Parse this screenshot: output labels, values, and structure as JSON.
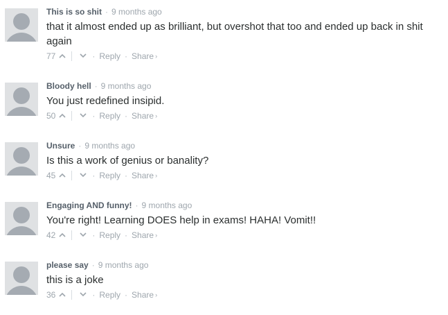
{
  "comments": [
    {
      "author": "This is so shit",
      "time": "9 months ago",
      "message": "that it almost ended up as brilliant, but overshot that too and ended up back in shit again",
      "votes": "77",
      "reply_label": "Reply",
      "share_label": "Share"
    },
    {
      "author": "Bloody hell",
      "time": "9 months ago",
      "message": "You just redefined insipid.",
      "votes": "50",
      "reply_label": "Reply",
      "share_label": "Share"
    },
    {
      "author": "Unsure",
      "time": "9 months ago",
      "message": "Is this a work of genius or banality?",
      "votes": "45",
      "reply_label": "Reply",
      "share_label": "Share"
    },
    {
      "author": "Engaging AND funny!",
      "time": "9 months ago",
      "message": "You're right! Learning DOES help in exams! HAHA! Vomit!!",
      "votes": "42",
      "reply_label": "Reply",
      "share_label": "Share"
    },
    {
      "author": "please say",
      "time": "9 months ago",
      "message": "this is a joke",
      "votes": "36",
      "reply_label": "Reply",
      "share_label": "Share"
    }
  ],
  "colors": {
    "author": "#555f69",
    "meta": "#9ea6ad",
    "message": "#2a2e2e",
    "avatar_bg": "#dfe1e3",
    "avatar_fg": "#a5abb2"
  },
  "icons": {
    "avatar": "default-user-avatar-icon",
    "upvote": "chevron-up-icon",
    "downvote": "chevron-down-icon",
    "share": "chevron-right-icon"
  }
}
